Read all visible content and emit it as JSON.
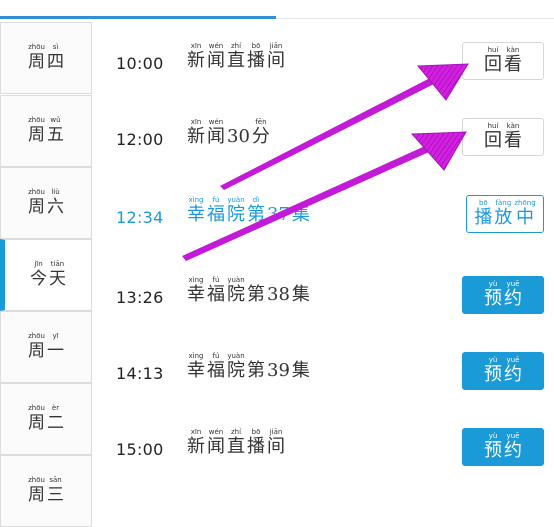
{
  "schedule": {
    "days": [
      {
        "glyphs": [
          {
            "py": "zhōu",
            "hz": "周"
          },
          {
            "py": "sì",
            "hz": "四"
          }
        ]
      },
      {
        "glyphs": [
          {
            "py": "zhōu",
            "hz": "周"
          },
          {
            "py": "wǔ",
            "hz": "五"
          }
        ]
      },
      {
        "glyphs": [
          {
            "py": "zhōu",
            "hz": "周"
          },
          {
            "py": "liù",
            "hz": "六"
          }
        ]
      },
      {
        "glyphs": [
          {
            "py": "jīn",
            "hz": "今"
          },
          {
            "py": "tiān",
            "hz": "天"
          }
        ],
        "active": true
      },
      {
        "glyphs": [
          {
            "py": "zhōu",
            "hz": "周"
          },
          {
            "py": "yī",
            "hz": "一"
          }
        ]
      },
      {
        "glyphs": [
          {
            "py": "zhōu",
            "hz": "周"
          },
          {
            "py": "èr",
            "hz": "二"
          }
        ]
      },
      {
        "glyphs": [
          {
            "py": "zhōu",
            "hz": "周"
          },
          {
            "py": "sān",
            "hz": "三"
          }
        ]
      }
    ],
    "programs": [
      {
        "time": "10:00",
        "title": [
          {
            "py": "xīn",
            "hz": "新"
          },
          {
            "py": "wén",
            "hz": "闻"
          },
          {
            "py": "zhí",
            "hz": "直"
          },
          {
            "py": "bō",
            "hz": "播"
          },
          {
            "py": "jiān",
            "hz": "间"
          }
        ],
        "button": "replay"
      },
      {
        "time": "12:00",
        "title": [
          {
            "py": "xīn",
            "hz": "新"
          },
          {
            "py": "wén",
            "hz": "闻"
          },
          {
            "py": "",
            "hz": "30"
          },
          {
            "py": "fēn",
            "hz": "分"
          }
        ],
        "button": "replay"
      },
      {
        "time": "12:34",
        "title": [
          {
            "py": "xìng",
            "hz": "幸"
          },
          {
            "py": "fú",
            "hz": "福"
          },
          {
            "py": "yuàn",
            "hz": "院"
          },
          {
            "py": "dì",
            "hz": "第"
          },
          {
            "py": "",
            "hz": "37"
          },
          {
            "py": "",
            "hz": "集"
          }
        ],
        "button": "playing",
        "playing": true
      },
      {
        "time": "13:26",
        "title": [
          {
            "py": "xìng",
            "hz": "幸"
          },
          {
            "py": "fú",
            "hz": "福"
          },
          {
            "py": "yuàn",
            "hz": "院"
          },
          {
            "py": "",
            "hz": "第"
          },
          {
            "py": "",
            "hz": "38"
          },
          {
            "py": "",
            "hz": "集"
          }
        ],
        "button": "reserve"
      },
      {
        "time": "14:13",
        "title": [
          {
            "py": "xìng",
            "hz": "幸"
          },
          {
            "py": "fú",
            "hz": "福"
          },
          {
            "py": "yuàn",
            "hz": "院"
          },
          {
            "py": "",
            "hz": "第"
          },
          {
            "py": "",
            "hz": "39"
          },
          {
            "py": "",
            "hz": "集"
          }
        ],
        "button": "reserve"
      },
      {
        "time": "15:00",
        "title": [
          {
            "py": "xīn",
            "hz": "新"
          },
          {
            "py": "wén",
            "hz": "闻"
          },
          {
            "py": "zhí",
            "hz": "直"
          },
          {
            "py": "bō",
            "hz": "播"
          },
          {
            "py": "jiān",
            "hz": "间"
          }
        ],
        "button": "reserve"
      }
    ]
  },
  "buttons": {
    "replay": [
      {
        "py": "huí",
        "hz": "回"
      },
      {
        "py": "kàn",
        "hz": "看"
      }
    ],
    "playing": [
      {
        "py": "bō",
        "hz": "播"
      },
      {
        "py": "fàng",
        "hz": "放"
      },
      {
        "py": "zhōng",
        "hz": "中"
      }
    ],
    "reserve": [
      {
        "py": "yù",
        "hz": "预"
      },
      {
        "py": "yuē",
        "hz": "约"
      }
    ]
  },
  "colors": {
    "accent": "#1a9ad6",
    "annotation_arrow": "#c21ad6",
    "divider": "#dcdcdc"
  }
}
